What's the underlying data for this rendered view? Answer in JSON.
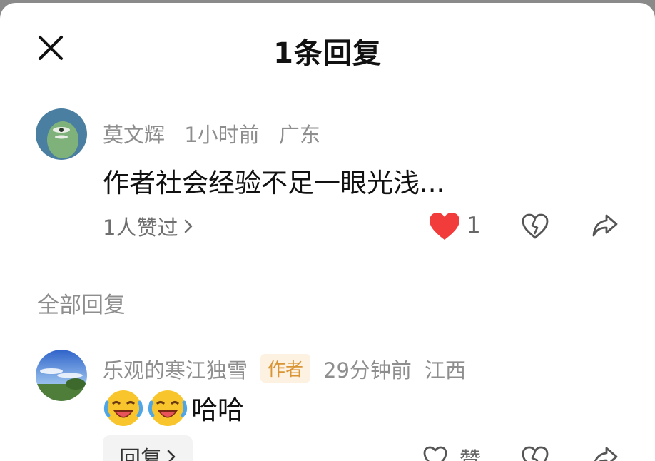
{
  "header": {
    "title": "1条回复"
  },
  "comment": {
    "username": "莫文辉",
    "time": "1小时前",
    "location": "广东",
    "text": "作者社会经验不足一眼光浅...",
    "likers_text": "1人赞过",
    "like_count": "1"
  },
  "section_label": "全部回复",
  "reply": {
    "username": "乐观的寒江独雪",
    "badge": "作者",
    "time": "29分钟前",
    "location": "江西",
    "text": "哈哈",
    "emojis": [
      "laughing-crying-face",
      "laughing-crying-face"
    ],
    "reply_button": "回复",
    "zan_label": "赞"
  },
  "colors": {
    "heart_red": "#f23b3b",
    "badge_text": "#d99433",
    "badge_bg": "#fdf1e2"
  }
}
